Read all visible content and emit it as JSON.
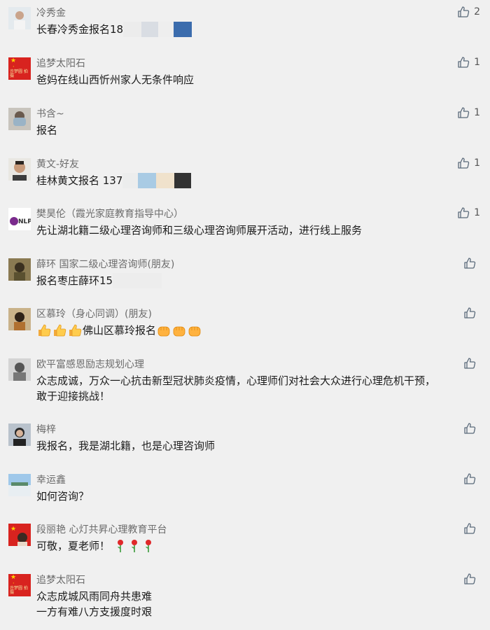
{
  "comments": [
    {
      "name": "冷秀金",
      "text": "长春冷秀金报名18",
      "likes": "2"
    },
    {
      "name": "追梦太阳石",
      "text": "爸妈在线山西忻州家人无条件响应",
      "likes": "1"
    },
    {
      "name": "书含~",
      "text": "报名",
      "likes": "1"
    },
    {
      "name": "黄文-好友",
      "text": "桂林黄文报名 137",
      "likes": "1"
    },
    {
      "name": "樊昊伦（霞光家庭教育指导中心）",
      "text": "先让湖北籍二级心理咨询师和三级心理咨询师展开活动，进行线上服务",
      "likes": "1",
      "avatar_label": "NLP"
    },
    {
      "name": "薛环 国家二级心理咨询师(朋友)",
      "text": "报名枣庄薛环15",
      "likes": ""
    },
    {
      "name": "区慕玲（身心同调）(朋友)",
      "text": "佛山区慕玲报名",
      "likes": ""
    },
    {
      "name": "欧平富感恩励志规划心理",
      "text": "众志成诚，万众一心抗击新型冠状肺炎疫情，心理师们对社会大众进行心理危机干预，",
      "text2": "敢于迎接挑战！",
      "likes": ""
    },
    {
      "name": "梅梓",
      "text": "我报名，我是湖北籍，也是心理咨询师",
      "likes": ""
    },
    {
      "name": "幸运鑫",
      "text": "如何咨询？",
      "likes": ""
    },
    {
      "name": "段丽艳 心灯共昇心理教育平台",
      "text": "可敬，夏老师！",
      "likes": ""
    },
    {
      "name": "追梦太阳石",
      "text": "众志成城风雨同舟共患难",
      "text2": "一方有难八方支援度时艰",
      "likes": ""
    }
  ],
  "flag_text": "许梦圆 拍摄",
  "colors": {
    "background": "#f0f0f0",
    "name": "#6b6b6b",
    "text": "#1b1b1b",
    "flag_red": "#d8231f"
  }
}
